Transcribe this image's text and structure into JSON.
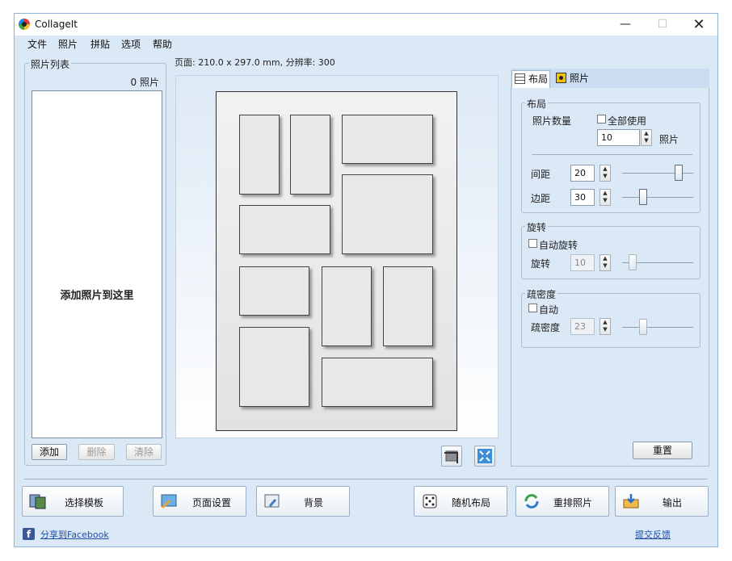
{
  "window": {
    "title": "CollageIt",
    "minimize": "—",
    "maximize": "☐",
    "close": "✕"
  },
  "menu": [
    "文件",
    "照片",
    "拼贴",
    "选项",
    "帮助"
  ],
  "photo_list": {
    "legend": "照片列表",
    "count": "0 照片",
    "drop_hint": "添加照片到这里",
    "add": "添加",
    "delete": "删除",
    "clear": "清除"
  },
  "page_info": "页面: 210.0 x 297.0 mm, 分辨率: 300",
  "tabs": {
    "layout": "布局",
    "photo": "照片"
  },
  "layout_group": {
    "legend": "布局",
    "photo_count_label": "照片数量",
    "use_all_label": "全部使用",
    "use_all_checked": false,
    "photo_count_value": "10",
    "photo_unit": "照片",
    "spacing_label": "间距",
    "spacing_value": "20",
    "spacing_level": 0.8,
    "margin_label": "边距",
    "margin_value": "30",
    "margin_level": 0.3
  },
  "rotation_group": {
    "legend": "旋转",
    "auto_label": "自动旋转",
    "auto_checked": false,
    "rotate_label": "旋转",
    "rotate_value": "10",
    "rotate_level": 0.15
  },
  "density_group": {
    "legend": "疏密度",
    "auto_label": "自动",
    "auto_checked": false,
    "density_label": "疏密度",
    "density_value": "23",
    "density_level": 0.3
  },
  "reset": "重置",
  "bottom_buttons": {
    "template": "选择模板",
    "page_setup": "页面设置",
    "background": "背景",
    "random_layout": "随机布局",
    "shuffle": "重排照片",
    "export": "输出"
  },
  "share": "分享到Facebook",
  "feedback": "提交反馈",
  "icons": [
    "app-icon",
    "crop-icon",
    "fit-icon",
    "template-icon",
    "page-setup-icon",
    "background-icon",
    "dice-icon",
    "shuffle-icon",
    "export-icon",
    "facebook-icon"
  ]
}
